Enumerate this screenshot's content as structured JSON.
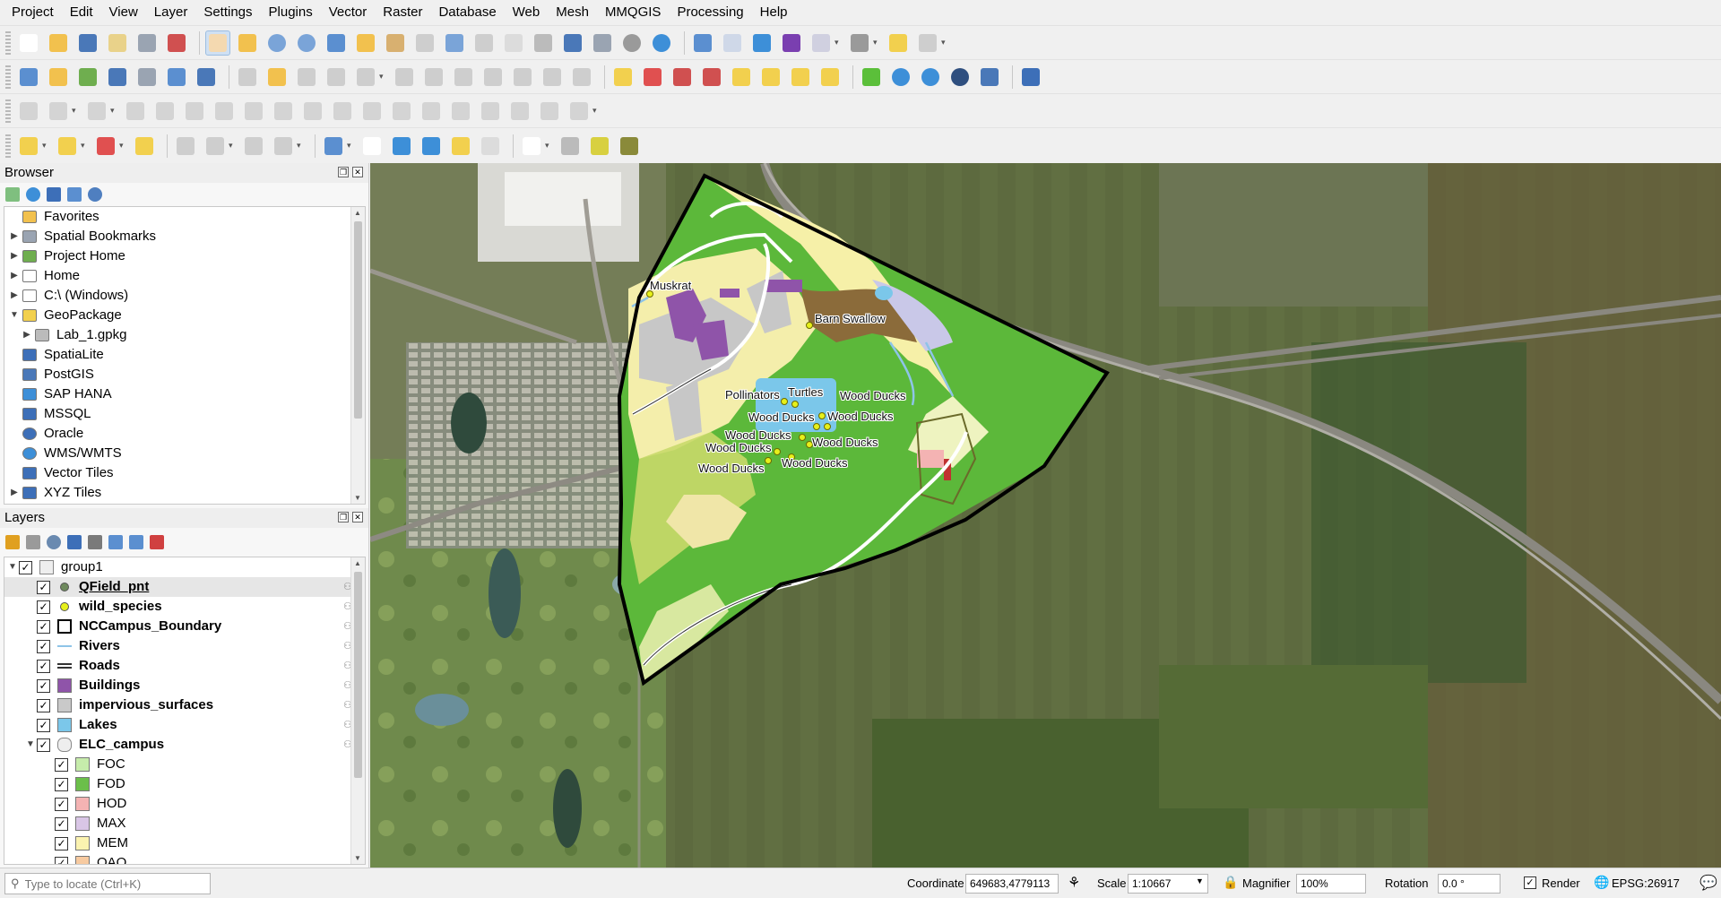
{
  "menu": [
    "Project",
    "Edit",
    "View",
    "Layer",
    "Settings",
    "Plugins",
    "Vector",
    "Raster",
    "Database",
    "Web",
    "Mesh",
    "MMQGIS",
    "Processing",
    "Help"
  ],
  "browser": {
    "title": "Browser",
    "items": [
      {
        "label": "Favorites",
        "icon": "star-icon",
        "arrow": ""
      },
      {
        "label": "Spatial Bookmarks",
        "icon": "bookmark-icon",
        "arrow": "▶"
      },
      {
        "label": "Project Home",
        "icon": "project-home-icon",
        "arrow": "▶"
      },
      {
        "label": "Home",
        "icon": "folder-icon",
        "arrow": "▶"
      },
      {
        "label": "C:\\ (Windows)",
        "icon": "drive-icon",
        "arrow": "▶"
      },
      {
        "label": "GeoPackage",
        "icon": "geopackage-icon",
        "arrow": "▼"
      },
      {
        "label": "Lab_1.gpkg",
        "icon": "database-icon",
        "arrow": "▶",
        "indent": 1
      },
      {
        "label": "SpatiaLite",
        "icon": "spatialite-icon",
        "arrow": ""
      },
      {
        "label": "PostGIS",
        "icon": "postgis-icon",
        "arrow": ""
      },
      {
        "label": "SAP HANA",
        "icon": "sap-hana-icon",
        "arrow": ""
      },
      {
        "label": "MSSQL",
        "icon": "mssql-icon",
        "arrow": ""
      },
      {
        "label": "Oracle",
        "icon": "oracle-icon",
        "arrow": ""
      },
      {
        "label": "WMS/WMTS",
        "icon": "globe-icon",
        "arrow": ""
      },
      {
        "label": "Vector Tiles",
        "icon": "grid-icon",
        "arrow": ""
      },
      {
        "label": "XYZ Tiles",
        "icon": "grid-icon",
        "arrow": "▶"
      }
    ]
  },
  "layers": {
    "title": "Layers",
    "items": [
      {
        "label": "group1",
        "type": "group",
        "indent": 0
      },
      {
        "label": "QField_pnt",
        "type": "point",
        "color": "#6f8a5e",
        "indent": 1,
        "underline": true
      },
      {
        "label": "wild_species",
        "type": "point",
        "color": "#e6f01b",
        "indent": 1
      },
      {
        "label": "NCCampus_Boundary",
        "type": "outline",
        "color": "#000000",
        "indent": 1
      },
      {
        "label": "Rivers",
        "type": "line",
        "color": "#8ec4e8",
        "indent": 1
      },
      {
        "label": "Roads",
        "type": "dline",
        "color": "#333333",
        "indent": 1
      },
      {
        "label": "Buildings",
        "type": "fill",
        "color": "#8f54a9",
        "indent": 1
      },
      {
        "label": "impervious_surfaces",
        "type": "fill",
        "color": "#c9c9c9",
        "indent": 1
      },
      {
        "label": "Lakes",
        "type": "fill",
        "color": "#7bc7ea",
        "indent": 1
      },
      {
        "label": "ELC_campus",
        "type": "group-poly",
        "indent": 1
      },
      {
        "label": "FOC",
        "type": "class",
        "color": "#c6ecab",
        "indent": 2
      },
      {
        "label": "FOD",
        "type": "class",
        "color": "#6bbf4a",
        "indent": 2
      },
      {
        "label": "HOD",
        "type": "class",
        "color": "#f4b3b3",
        "indent": 2
      },
      {
        "label": "MAX",
        "type": "class",
        "color": "#d9c6e6",
        "indent": 2
      },
      {
        "label": "MEM",
        "type": "class",
        "color": "#fbf3b0",
        "indent": 2
      },
      {
        "label": "OAO",
        "type": "class",
        "color": "#f7caa0",
        "indent": 2
      }
    ]
  },
  "map_labels": [
    {
      "text": "Muskrat"
    },
    {
      "text": "Barn Swallow"
    },
    {
      "text": "Pollinators"
    },
    {
      "text": "Turtles"
    },
    {
      "text": "Wood Ducks"
    },
    {
      "text": "Wood Ducks"
    },
    {
      "text": "Wood Ducks"
    },
    {
      "text": "Wood Ducks"
    },
    {
      "text": "Wood Ducks"
    },
    {
      "text": "Wood Ducks"
    },
    {
      "text": "Wood Ducks"
    },
    {
      "text": "Wood Ducks"
    }
  ],
  "status": {
    "locator_placeholder": "Type to locate (Ctrl+K)",
    "coordinate_label": "Coordinate",
    "coordinate_value": "649683,4779113",
    "scale_label": "Scale",
    "scale_value": "1:10667",
    "magnifier_label": "Magnifier",
    "magnifier_value": "100%",
    "rotation_label": "Rotation",
    "rotation_value": "0.0 °",
    "render_label": "Render",
    "crs_label": "EPSG:26917"
  },
  "colors": {
    "accent": "#cfe0f3",
    "foc": "#c6ecab",
    "fod": "#6bbf4a",
    "boundary": "#000000"
  }
}
